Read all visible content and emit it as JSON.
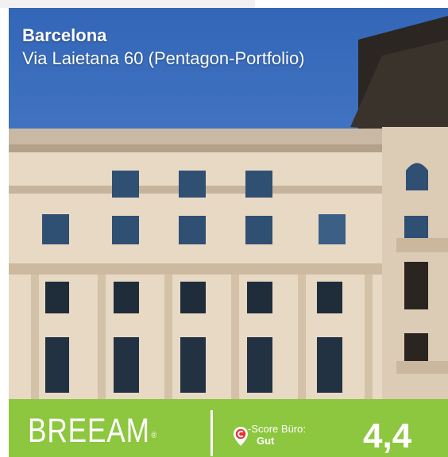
{
  "listing": {
    "city": "Barcelona",
    "address": "Via Laietana 60 (Pentagon-Portfolio)"
  },
  "certification": {
    "brand": "BREEAM",
    "registered_mark": "®",
    "score_label": "-Score Büro:",
    "rating": "Gut",
    "score": "4,4"
  },
  "icons": {
    "score_pin": "map-pin-c-icon"
  },
  "colors": {
    "band": "#8dc63f",
    "sky": "#3d71c0",
    "facade": "#e8d9c5",
    "pin": "#e3342f"
  }
}
